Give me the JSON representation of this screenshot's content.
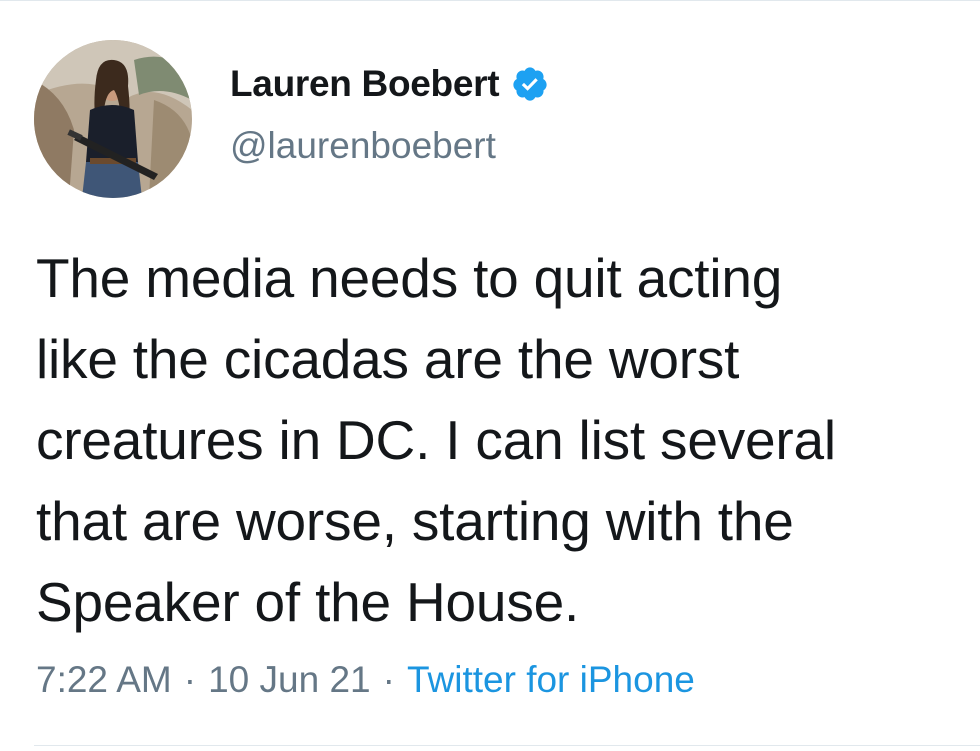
{
  "author": {
    "display_name": "Lauren Boebert",
    "handle": "@laurenboebert",
    "verified": true,
    "avatar_icon": "profile-photo"
  },
  "tweet": {
    "text": "The media needs to quit acting like the cicadas are the worst creatures in DC. I can list several that are worse, starting with the Speaker of the House.",
    "lines": [
      "The media needs to quit acting",
      "like the cicadas are the worst",
      "creatures in DC. I can list several",
      "that are worse, starting with the",
      "Speaker of the House."
    ]
  },
  "meta": {
    "time": "7:22 AM",
    "separator": "·",
    "date": "10 Jun 21",
    "source": "Twitter for iPhone"
  },
  "colors": {
    "text": "#14171a",
    "secondary": "#657786",
    "link": "#1b95e0",
    "verified_badge": "#1da1f2"
  }
}
